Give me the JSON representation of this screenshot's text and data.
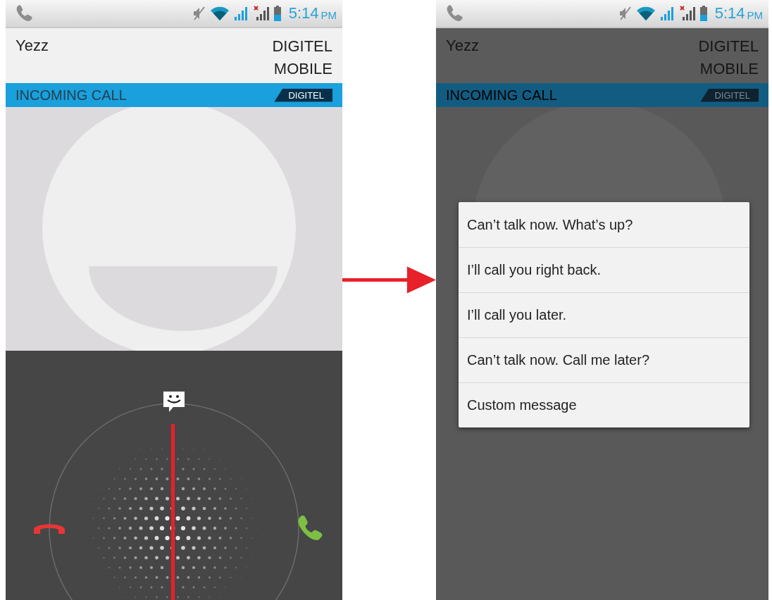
{
  "screens": [
    {
      "dimmed": false,
      "status_bar": {
        "time": "5:14",
        "suffix": "PM"
      },
      "header": {
        "name": "Yezz",
        "carrier_lines": [
          "DIGITEL",
          "MOBILE"
        ]
      },
      "call_bar": {
        "label": "INCOMING CALL",
        "badge": "DIGITEL"
      }
    },
    {
      "dimmed": true,
      "status_bar": {
        "time": "5:14",
        "suffix": "PM"
      },
      "header": {
        "name": "Yezz",
        "carrier_lines": [
          "DIGITEL",
          "MOBILE"
        ]
      },
      "call_bar": {
        "label": "INCOMING CALL",
        "badge": "DIGITEL"
      },
      "quick_responses": [
        "Can’t talk now. What’s up?",
        "I’ll call you right back.",
        "I’ll call you later.",
        "Can’t talk now. Call me later?",
        "Custom message"
      ]
    }
  ]
}
